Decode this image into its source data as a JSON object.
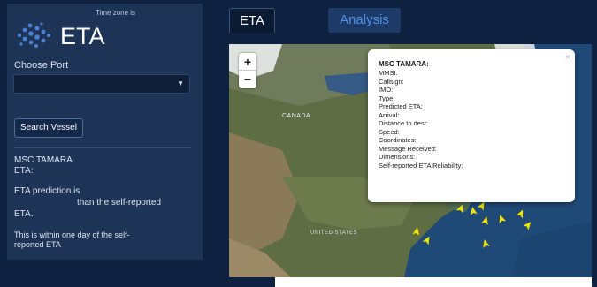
{
  "sidebar": {
    "app_title": "ETA",
    "timezone_label": "Time zone is",
    "choose_port_label": "Choose Port",
    "port_select_value": "",
    "search_button_label": "Search Vessel",
    "vessel_name": "MSC TAMARA",
    "eta_label": "ETA:",
    "eta_prediction_part1": "ETA prediction is",
    "eta_prediction_part2": "than the self-reported",
    "eta_word": "ETA.",
    "within_line1": "This is within one day of the self-",
    "within_line2": "reported ETA"
  },
  "tabs": [
    {
      "label": "ETA",
      "active": true
    },
    {
      "label": "Analysis",
      "active": false
    }
  ],
  "map": {
    "zoom_in_label": "+",
    "zoom_out_label": "−",
    "region_label_canada": "CANADA",
    "region_label_us": "UNITED STATES",
    "marker_color": "#f3e500",
    "vessel_marker_count": 10,
    "popup": {
      "title": "MSC TAMARA:",
      "close_label": "×",
      "fields": [
        "MMSI:",
        "Callsign:",
        "IMO:",
        "Type:",
        "Predicted ETA:",
        "Arrival:",
        "Distance to dest:",
        "Speed:",
        "Coordinates:",
        "Message Received:",
        "Dimensions:",
        "Self-reported ETA Reliability:"
      ]
    }
  },
  "colors": {
    "background": "#0e2141",
    "sidebar": "#1d3457",
    "accent": "#4f93e6"
  }
}
